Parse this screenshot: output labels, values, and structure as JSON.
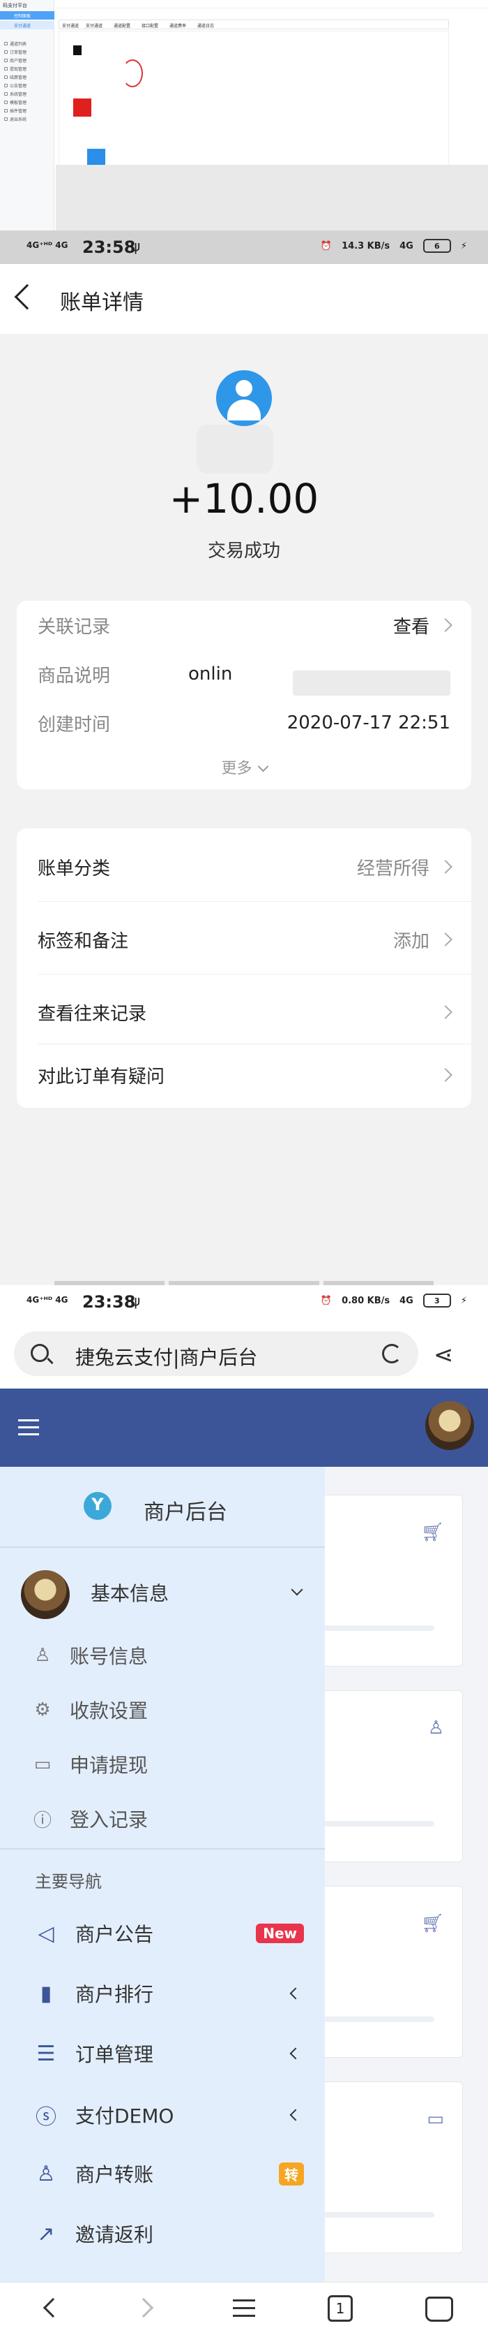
{
  "desktop": {
    "brand": "码支付平台",
    "sidebar_items": [
      "支付通道",
      "通道列表",
      "订单管理",
      "商户管理",
      "提现管理",
      "结算管理",
      "公告管理",
      "系统管理",
      "模板管理",
      "插件管理",
      "退出系统"
    ],
    "active_item": "控制面板",
    "tabs": [
      "支付通道",
      "支付通道",
      "通道配置",
      "接口配置",
      "通道费率",
      "通道日志"
    ]
  },
  "bill": {
    "status": {
      "signal": "4G⁺ᴴᴰ 4G",
      "time": "23:58",
      "speed": "14.3 KB/s",
      "net": "4G",
      "battery": "6"
    },
    "title": "账单详情",
    "amount": "+10.00",
    "result": "交易成功",
    "info": {
      "related_label": "关联记录",
      "related_value": "查看",
      "desc_label": "商品说明",
      "desc_value": "onlin",
      "time_label": "创建时间",
      "time_value": "2020-07-17 22:51",
      "more": "更多"
    },
    "actions": {
      "category_label": "账单分类",
      "category_value": "经营所得",
      "tag_label": "标签和备注",
      "tag_value": "添加",
      "history_label": "查看往来记录",
      "question_label": "对此订单有疑问"
    }
  },
  "merchant": {
    "status": {
      "signal": "4G⁺ᴴᴰ 4G",
      "time": "23:38",
      "speed": "0.80 KB/s",
      "net": "4G",
      "battery": "3"
    },
    "url_text": "捷兔云支付|商户后台",
    "drawer_title": "商户后台",
    "basic_info": "基本信息",
    "sub_items": [
      {
        "icon": "user-icon",
        "glyph": "♙",
        "label": "账号信息"
      },
      {
        "icon": "gear-icon",
        "glyph": "⚙",
        "label": "收款设置"
      },
      {
        "icon": "folder-icon",
        "glyph": "▭",
        "label": "申请提现"
      },
      {
        "icon": "info-icon",
        "glyph": "ⓘ",
        "label": "登入记录"
      }
    ],
    "section": "主要导航",
    "nav_items": [
      {
        "icon": "speaker-icon",
        "glyph": "◁",
        "label": "商户公告",
        "badge": "New"
      },
      {
        "icon": "bar-chart-icon",
        "glyph": "▮",
        "label": "商户排行"
      },
      {
        "icon": "list-icon",
        "glyph": "☰",
        "label": "订单管理"
      },
      {
        "icon": "skype-icon",
        "glyph": "ⓢ",
        "label": "支付DEMO"
      },
      {
        "icon": "users-icon",
        "glyph": "♙",
        "label": "商户转账",
        "badge": "转"
      },
      {
        "icon": "share-icon",
        "glyph": "↗",
        "label": "邀请返利"
      }
    ],
    "bottom_tabs_count": "1"
  }
}
